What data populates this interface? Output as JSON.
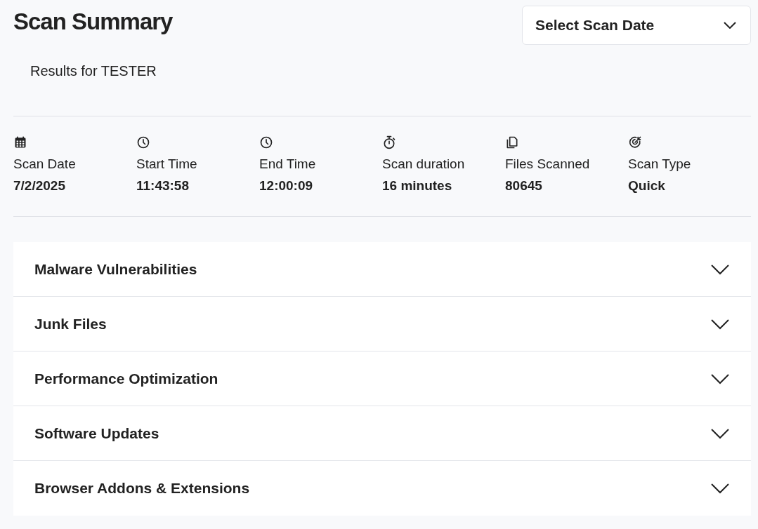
{
  "title": "Scan Summary",
  "date_select": {
    "label": "Select Scan Date"
  },
  "subtitle": "Results for TESTER",
  "stats": [
    {
      "kind": "calendar",
      "label": "Scan Date",
      "value": "7/2/2025"
    },
    {
      "kind": "clock",
      "label": "Start Time",
      "value": "11:43:58"
    },
    {
      "kind": "clock",
      "label": "End Time",
      "value": "12:00:09"
    },
    {
      "kind": "stopwatch",
      "label": "Scan duration",
      "value": "16 minutes"
    },
    {
      "kind": "files",
      "label": "Files Scanned",
      "value": "80645"
    },
    {
      "kind": "target",
      "label": "Scan Type",
      "value": "Quick"
    }
  ],
  "sections": [
    {
      "label": "Malware Vulnerabilities",
      "expanded": false
    },
    {
      "label": "Junk Files",
      "expanded": false
    },
    {
      "label": "Performance Optimization",
      "expanded": false
    },
    {
      "label": "Software Updates",
      "expanded": false
    },
    {
      "label": "Browser Addons & Extensions",
      "expanded": false
    }
  ]
}
